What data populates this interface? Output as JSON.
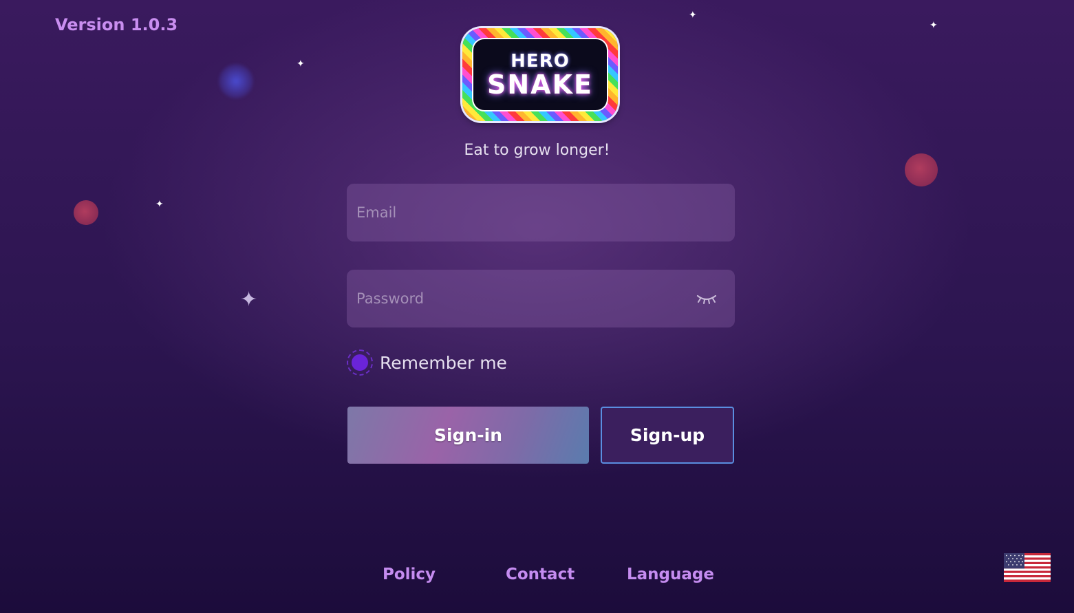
{
  "version": "Version 1.0.3",
  "logo": {
    "line1": "HERO",
    "line2": "SNAKE"
  },
  "tagline": "Eat to grow longer!",
  "form": {
    "email_placeholder": "Email",
    "email_value": "",
    "password_placeholder": "Password",
    "password_value": "",
    "remember_label": "Remember me",
    "remember_checked": true
  },
  "buttons": {
    "signin": "Sign-in",
    "signup": "Sign-up"
  },
  "footer": {
    "policy": "Policy",
    "contact": "Contact",
    "language": "Language"
  },
  "language_flag": "us-flag-icon",
  "colors": {
    "accent": "#c58cf0",
    "radio": "#6a24d8",
    "signup_border": "#5a8ee0"
  }
}
